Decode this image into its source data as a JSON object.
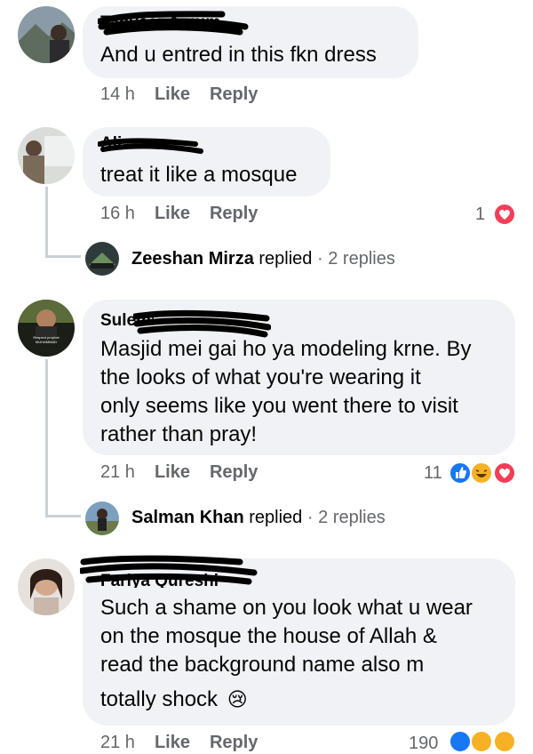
{
  "comments": [
    {
      "author": "Tanveer Anjum",
      "text": "And u entred in this fkn dress",
      "time": "14 h",
      "like": "Like",
      "reply": "Reply"
    },
    {
      "author": "Ali",
      "text": "treat it like a mosque",
      "time": "16 h",
      "like": "Like",
      "reply": "Reply",
      "reaction_count": "1",
      "replied": {
        "name": "Zeeshan Mirza",
        "verb": "replied",
        "sep": "·",
        "count": "2 replies"
      }
    },
    {
      "author": "Suleman",
      "text_lines": [
        "Masjid mei gai ho ya modeling krne. By",
        "the looks of what you're wearing it",
        "only seems like you went there to visit",
        "rather than pray!"
      ],
      "avatar_caption": "Respect prophet MUHAMMAD",
      "time": "21 h",
      "like": "Like",
      "reply": "Reply",
      "reaction_count": "11",
      "replied": {
        "name": "Salman Khan",
        "verb": "replied",
        "sep": "·",
        "count": "2 replies"
      }
    },
    {
      "author": "Fariya Qureshi",
      "text_lines": [
        "Such a shame on you look what u wear",
        "on the mosque the house of Allah &",
        "read the background name also m",
        "totally shock"
      ],
      "emoji": "😢",
      "time": "21 h",
      "like": "Like",
      "reply": "Reply",
      "reaction_count": "190"
    }
  ],
  "colors": {
    "bubble": "#f0f2f5",
    "meta": "#65676b",
    "like_blue": "#1877f2",
    "love_red": "#f33e58",
    "haha_yellow": "#f7b125"
  }
}
